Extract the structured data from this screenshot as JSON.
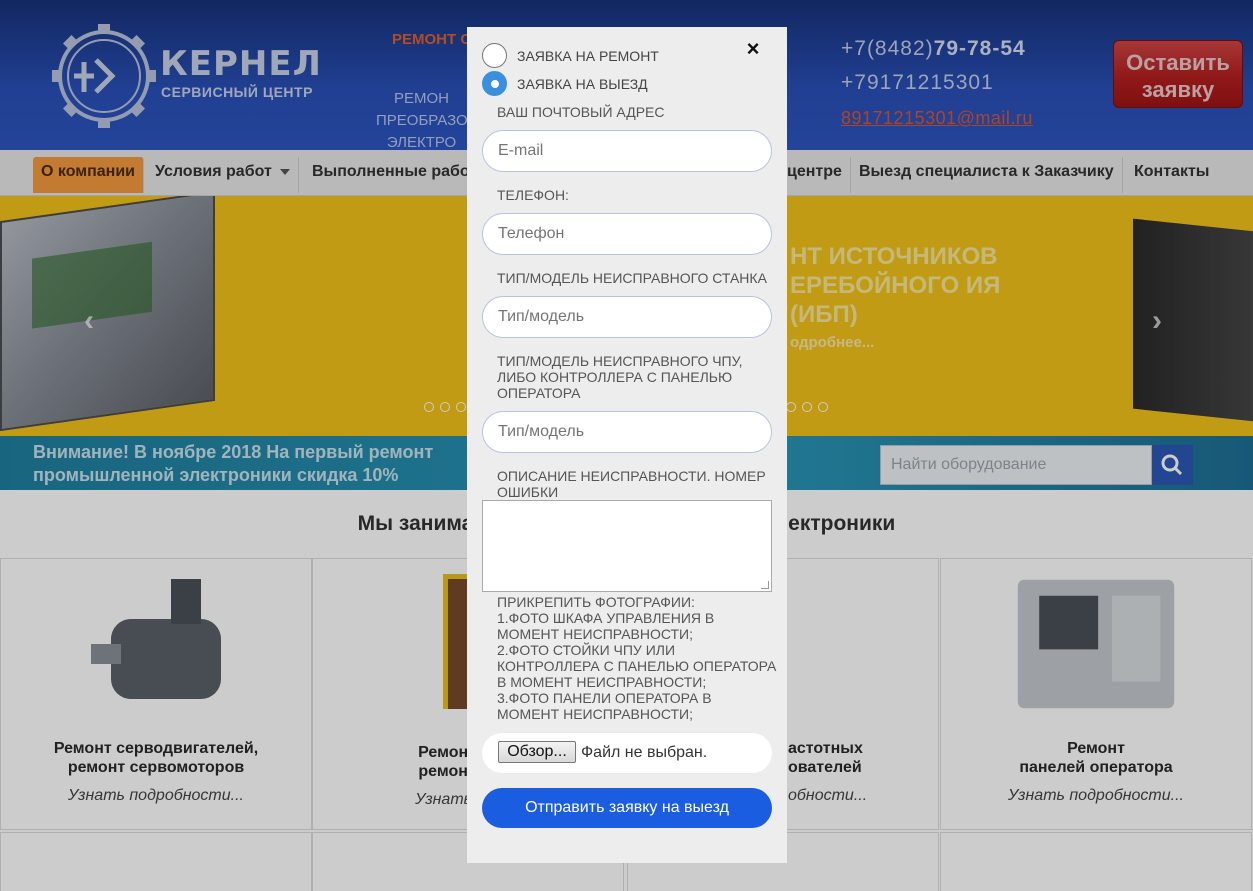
{
  "header": {
    "logo_title": "КЕРНЕЛ",
    "logo_subtitle": "СЕРВИСНЫЙ ЦЕНТР",
    "tagline_red": "РЕМОНТ С",
    "tagline_lines": [
      "РЕМОН",
      "ПРЕОБРАЗО",
      "ЭЛЕКТРО"
    ],
    "phone1_prefix": "+7(8482)",
    "phone1_number": "79-78-54",
    "phone2": "+79171215301",
    "email": "89171215301@mail.ru",
    "leave_request_line1": "Оставить",
    "leave_request_line2": "заявку"
  },
  "nav": {
    "items": [
      "О компании",
      "Условия работ",
      "Выполненные рабо",
      "центре",
      "Выезд специалиста к Заказчику",
      "Контакты"
    ]
  },
  "slider": {
    "title": "НТ ИСТОЧНИКОВ ЕРЕБОЙНОГО ИЯ (ИБП)",
    "more": "одробнее...",
    "prev_arrow": "‹",
    "next_arrow": "›"
  },
  "promo": {
    "line1": "Внимание! В ноябре 2018 На первый ремонт",
    "line2": "промышленной электроники скидка 10%",
    "search_placeholder": "Найти оборудование"
  },
  "section_heading": "Мы занимаем                                          й электроники",
  "cards": [
    {
      "title_line1": "Ремонт серводвигателей,",
      "title_line2": "ремонт сервомоторов",
      "more": "Узнать подробности..."
    },
    {
      "title_line1": "Ремонт серв",
      "title_line2": "ремонт серв",
      "more": "Узнать подро"
    },
    {
      "title_line1": "астотных",
      "title_line2": "ователей",
      "more": "обности..."
    },
    {
      "title_line1": "Ремонт",
      "title_line2": "панелей оператора",
      "more": "Узнать подробности..."
    }
  ],
  "modal": {
    "close": "×",
    "radio_repair": "ЗАЯВКА НА РЕМОНТ",
    "radio_visit": "ЗАЯВКА НА ВЫЕЗД",
    "selected": "ЗАЯВКА НА ВЫЕЗД",
    "email_label": "ВАШ ПОЧТОВЫЙ АДРЕС",
    "email_placeholder": "E-mail",
    "phone_label": "ТЕЛЕФОН:",
    "phone_placeholder": "Телефон",
    "machine_label": "ТИП/МОДЕЛЬ НЕИСПРАВНОГО СТАНКА",
    "machine_placeholder": "Тип/модель",
    "cnc_label": "ТИП/МОДЕЛЬ НЕИСПРАВНОГО ЧПУ, ЛИБО КОНТРОЛЛЕРА С ПАНЕЛЬЮ ОПЕРАТОРА",
    "cnc_placeholder": "Тип/модель",
    "description_label": "ОПИСАНИЕ НЕИСПРАВНОСТИ. НОМЕР ОШИБКИ",
    "description_value": "",
    "photos_label_lines": [
      "ПРИКРЕПИТЬ ФОТОГРАФИИ:",
      "1.ФОТО ШКАФА УПРАВЛЕНИЯ В МОМЕНТ НЕИСПРАВНОСТИ;",
      "2.ФОТО СТОЙКИ ЧПУ ИЛИ КОНТРОЛЛЕРА С ПАНЕЛЬЮ ОПЕРАТОРА В МОМЕНТ НЕИСПРАВНОСТИ;",
      "3.ФОТО ПАНЕЛИ ОПЕРАТОРА В МОМЕНТ НЕИСПРАВНОСТИ;"
    ],
    "file_button": "Обзор...",
    "file_status": "Файл не выбран.",
    "submit": "Отправить заявку на выезд"
  },
  "colors": {
    "header_blue": "#2a50b8",
    "accent_orange": "#f39a3c",
    "slider_yellow": "#f2c21a",
    "submit_blue": "#1a5de0",
    "radio_checked": "#3a8fde"
  }
}
